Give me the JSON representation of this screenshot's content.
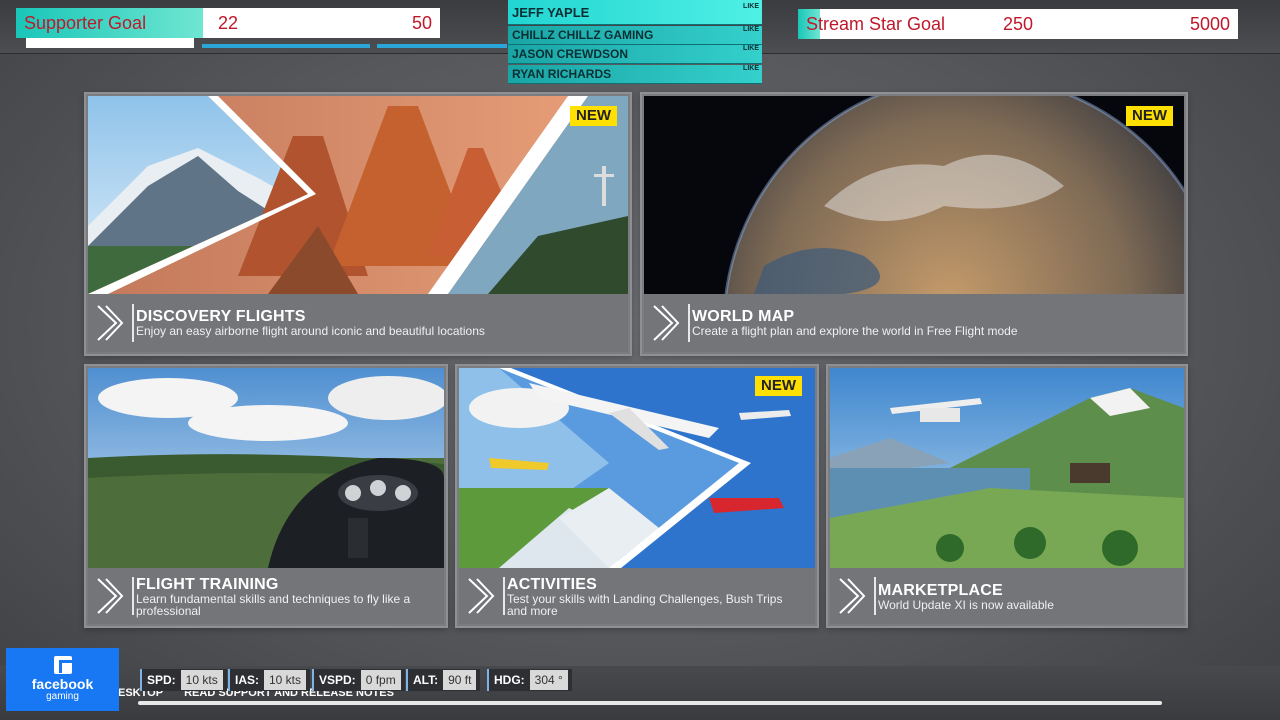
{
  "overlay": {
    "supporter_goal": {
      "title": "Supporter Goal",
      "current": "22",
      "max": "50",
      "progress": 0.44
    },
    "stream_star_goal": {
      "title": "Stream Star Goal",
      "current": "250",
      "max": "5000",
      "progress": 0.05
    },
    "likes": [
      {
        "name": "JEFF YAPLE",
        "tag": "LIKE"
      },
      {
        "name": "CHILLZ CHILLZ GAMING",
        "tag": "LIKE"
      },
      {
        "name": "JASON CREWDSON",
        "tag": "LIKE"
      },
      {
        "name": "RYAN RICHARDS",
        "tag": "LIKE"
      }
    ],
    "facebook": {
      "line1": "facebook",
      "line2": "gaming"
    }
  },
  "cards": {
    "discovery": {
      "badge": "NEW",
      "title": "DISCOVERY FLIGHTS",
      "desc": "Enjoy an easy airborne flight around iconic and beautiful locations"
    },
    "world_map": {
      "badge": "NEW",
      "title": "WORLD MAP",
      "desc": "Create a flight plan and explore the world in Free Flight mode"
    },
    "training": {
      "title": "FLIGHT TRAINING",
      "desc": "Learn fundamental skills and techniques to fly like a professional"
    },
    "activities": {
      "badge": "NEW",
      "title": "ACTIVITIES",
      "desc": "Test your skills with Landing Challenges, Bush Trips and more"
    },
    "marketplace": {
      "title": "MARKETPLACE",
      "desc": "World Update XI is now available"
    }
  },
  "bottom": {
    "links": [
      "ESKTOP",
      "READ SUPPORT AND RELEASE NOTES"
    ],
    "hud": [
      {
        "label": "SPD:",
        "value": "10 kts"
      },
      {
        "label": "IAS:",
        "value": "10 kts"
      },
      {
        "label": "VSPD:",
        "value": "0 fpm"
      },
      {
        "label": "ALT:",
        "value": "90 ft"
      },
      {
        "label": "HDG:",
        "value": "304 °"
      }
    ]
  }
}
